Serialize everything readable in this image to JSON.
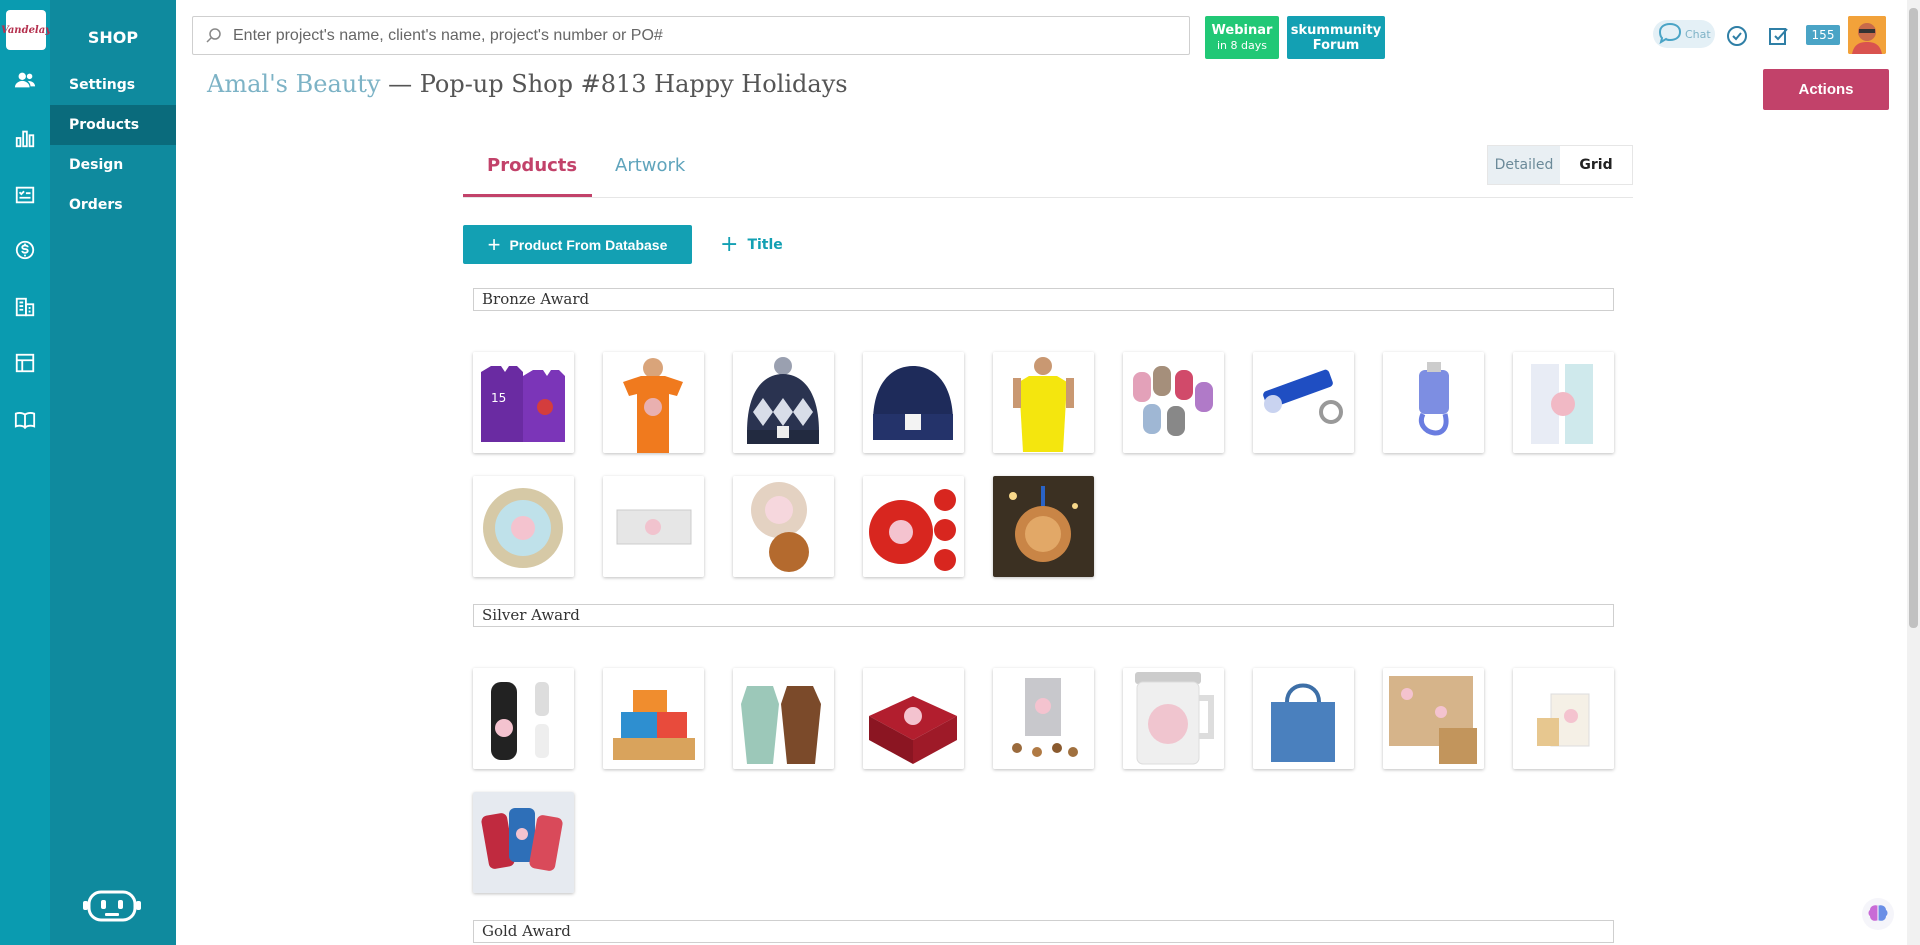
{
  "rail": {
    "logo_text": "Vandelay",
    "icons": [
      "clients-icon",
      "reports-icon",
      "tasks-icon",
      "billing-icon",
      "companies-icon",
      "layout-icon",
      "knowledge-book-icon"
    ]
  },
  "side_menu": {
    "title": "SHOP",
    "items": [
      {
        "label": "Settings"
      },
      {
        "label": "Products"
      },
      {
        "label": "Design"
      },
      {
        "label": "Orders"
      }
    ]
  },
  "search": {
    "placeholder": "Enter project's name, client's name, project's number or PO#"
  },
  "webinar": {
    "label": "Webinar",
    "sub": "in 8 days"
  },
  "forum": {
    "line1": "skummunity",
    "line2": "Forum"
  },
  "chat_label": "Chat",
  "notification_count": "155",
  "page": {
    "client": "Amal's Beauty",
    "separator": " — ",
    "title": "Pop-up Shop #813 Happy Holidays"
  },
  "actions_label": "Actions",
  "tabs": [
    {
      "label": "Products"
    },
    {
      "label": "Artwork"
    }
  ],
  "view_toggle": {
    "detailed": "Detailed",
    "grid": "Grid"
  },
  "add_product_label": "Product From Database",
  "add_title_label": "Title",
  "sections": [
    {
      "title": "Bronze Award",
      "products": [
        "basketball-jersey",
        "orange-tshirt",
        "argyle-beanie",
        "navy-beanie",
        "yellow-tank-top",
        "mittens-set",
        "flashlight-keychain",
        "hand-sanitizer-holder",
        "lip-balm-set",
        "tin-candle",
        "clear-pouch",
        "coaster-set",
        "red-ornaments",
        "wooden-ornament"
      ]
    },
    {
      "title": "Silver Award",
      "products": [
        "water-bottles",
        "gift-tower",
        "aprons",
        "chocolate-box",
        "snack-gift-set",
        "steel-mug",
        "denim-tote",
        "kraft-wrapping-paper",
        "gift-box",
        "phone-cases"
      ]
    },
    {
      "title": "Gold Award",
      "products": []
    }
  ],
  "colors": {
    "rail": "#0a9bb0",
    "side": "#0f8a9e",
    "accent": "#c2426a",
    "primary": "#13a0b3",
    "webinar": "#21c876"
  }
}
